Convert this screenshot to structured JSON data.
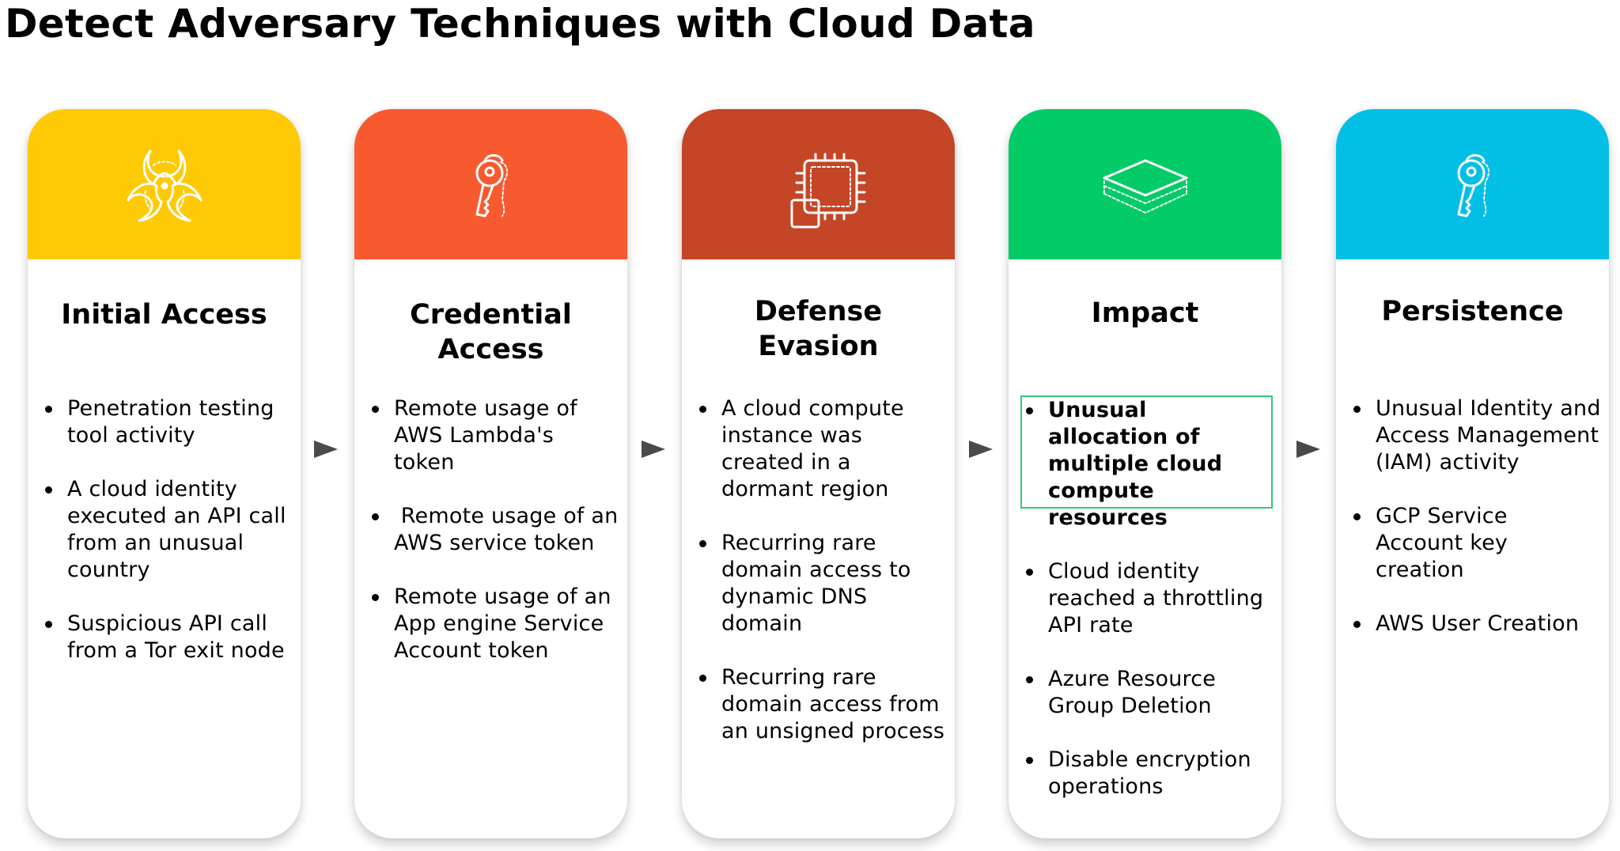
{
  "title": "Detect Adversary Techniques with Cloud Data",
  "colors": {
    "initial_access": "#FDCA05",
    "credential_access": "#F85A30",
    "defense_evasion": "#C44626",
    "impact": "#03CB67",
    "persistence": "#03BFE5",
    "highlight_border": "#2ECC71",
    "arrow": "#4A4A4A"
  },
  "stages": [
    {
      "name": "Initial Access",
      "icon": "biohazard-icon",
      "items": [
        {
          "text": "Penetration testing tool activity",
          "highlighted": false
        },
        {
          "text": "A cloud identity executed an API call from an unusual country",
          "highlighted": false
        },
        {
          "text": "Suspicious API call from a Tor exit node",
          "highlighted": false
        }
      ]
    },
    {
      "name": "Credential Access",
      "icon": "keys-icon",
      "items": [
        {
          "text": "Remote usage of AWS Lambda's token",
          "highlighted": false
        },
        {
          "text": " Remote usage of an AWS service token",
          "highlighted": false
        },
        {
          "text": "Remote usage of an App engine Service Account token",
          "highlighted": false
        }
      ]
    },
    {
      "name": "Defense Evasion",
      "icon": "cpu-chip-icon",
      "items": [
        {
          "text": "A cloud compute instance was created in a dormant region",
          "highlighted": false
        },
        {
          "text": "Recurring rare domain access to dynamic DNS domain",
          "highlighted": false
        },
        {
          "text": "Recurring rare domain access from an unsigned process",
          "highlighted": false
        }
      ]
    },
    {
      "name": "Impact",
      "icon": "layers-icon",
      "items": [
        {
          "text": "Unusual allocation of multiple cloud compute resources",
          "highlighted": true
        },
        {
          "text": "Cloud identity reached a throttling API rate",
          "highlighted": false
        },
        {
          "text": "Azure Resource Group Deletion",
          "highlighted": false
        },
        {
          "text": "Disable encryption operations",
          "highlighted": false
        }
      ]
    },
    {
      "name": "Persistence",
      "icon": "keys-icon",
      "items": [
        {
          "text": "Unusual Identity and Access Management (IAM) activity",
          "highlighted": false
        },
        {
          "text": "GCP Service Account key creation",
          "highlighted": false
        },
        {
          "text": "AWS User Creation",
          "highlighted": false
        }
      ]
    }
  ]
}
